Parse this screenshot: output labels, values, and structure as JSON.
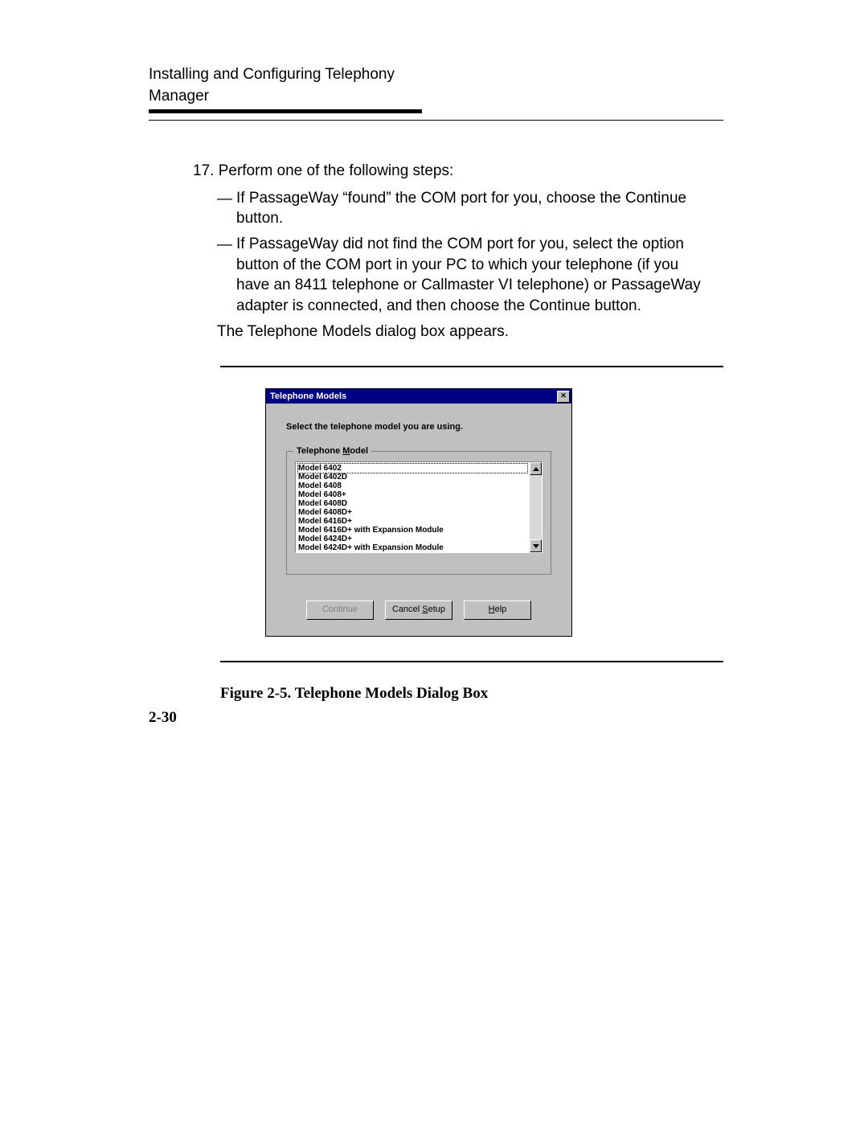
{
  "header_title": "Installing and Configuring Telephony Manager",
  "step_number": "17.",
  "step_text": "Perform one of the following steps:",
  "bullet_a": "If PassageWay “found” the COM port for you, choose the Continue button.",
  "bullet_b": "If PassageWay did not find the COM port for you, select the option button of the COM port in your PC to which your telephone (if you have an 8411 telephone or Callmaster VI telephone) or PassageWay adapter is connected, and then choose the Continue button.",
  "followup_text": "The Telephone Models dialog box appears.",
  "dialog": {
    "title": "Telephone Models",
    "instruction": "Select the telephone model you are using.",
    "group_label": "Telephone Model",
    "models": [
      "Model 6402",
      "Model 6402D",
      "Model 6408",
      "Model 6408+",
      "Model 6408D",
      "Model 6408D+",
      "Model 6416D+",
      "Model 6416D+ with Expansion Module",
      "Model 6424D+",
      "Model 6424D+ with Expansion Module"
    ],
    "buttons": {
      "continue": "Continue",
      "cancel_pre": "Cancel ",
      "cancel_u": "S",
      "cancel_post": "etup",
      "help_u": "H",
      "help_post": "elp"
    }
  },
  "figure_caption": "Figure 2-5.  Telephone Models Dialog Box",
  "page_number": "2-30",
  "group_label_pre": "Telephone ",
  "group_label_u": "M",
  "group_label_post": "odel"
}
